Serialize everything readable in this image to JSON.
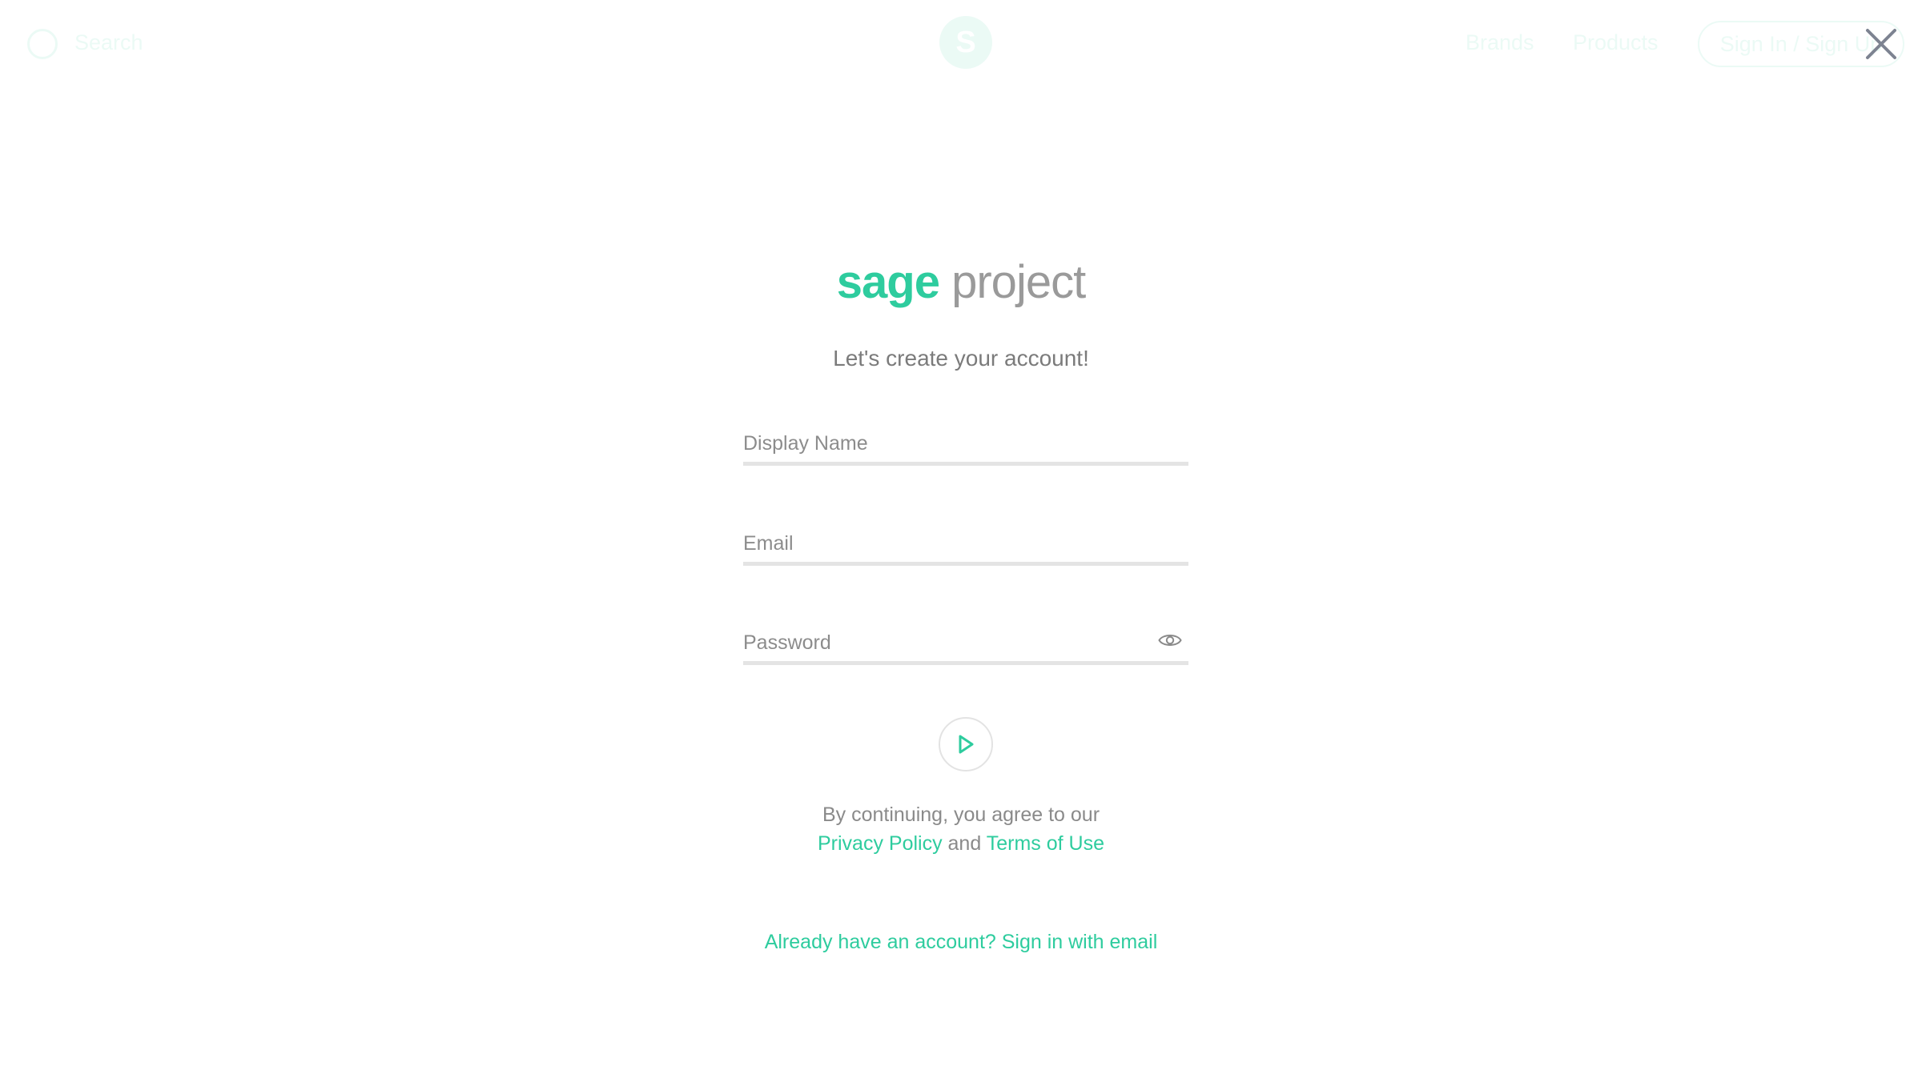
{
  "background_header": {
    "search_label": "Search",
    "logo_letter": "S",
    "nav_brands": "Brands",
    "nav_products": "Products",
    "signin_label": "Sign In / Sign Up"
  },
  "colors": {
    "accent": "#2ecc9e",
    "text_muted": "#7b7b7b",
    "brand_gray": "#9a9a9a"
  },
  "modal": {
    "close_icon": "close-icon",
    "brand": {
      "part1": "sage",
      "part2": "project"
    },
    "subtitle": "Let's create your account!",
    "fields": {
      "display_name": {
        "placeholder": "Display Name",
        "value": ""
      },
      "email": {
        "placeholder": "Email",
        "value": ""
      },
      "password": {
        "placeholder": "Password",
        "value": "",
        "toggle_icon": "eye-icon"
      }
    },
    "submit_icon": "play-arrow-icon",
    "terms": {
      "prefix": "By continuing, you agree to our",
      "privacy": "Privacy Policy",
      "and": "and",
      "terms_of_use": "Terms of Use"
    },
    "signin_link": "Already have an account? Sign in with email"
  }
}
